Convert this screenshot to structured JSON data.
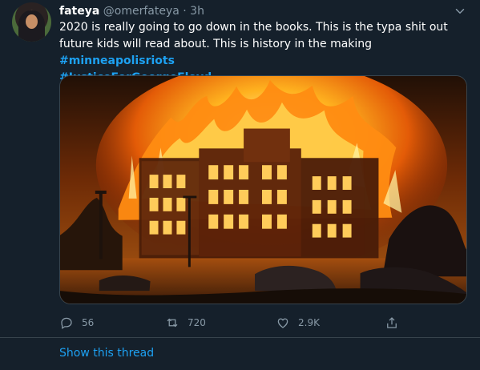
{
  "tweet": {
    "name": "fateya",
    "handle": "@omerfateya",
    "separator": "·",
    "time": "3h",
    "text_plain": "2020 is really going to go down in the books. This is the typa shit out future kids will read about. This is history in the making",
    "hashtags": [
      "#minneapolisriots",
      "#JusticeForGeorgeFloyd"
    ],
    "media_icon": "building-fire-photo"
  },
  "actions": {
    "reply_count": "56",
    "retweet_count": "720",
    "like_count": "2.9K",
    "reply_icon": "reply-icon",
    "retweet_icon": "retweet-icon",
    "like_icon": "heart-icon",
    "share_icon": "share-icon"
  },
  "thread": {
    "link_label": "Show this thread"
  },
  "colors": {
    "background": "#15202b",
    "text": "#ffffff",
    "muted": "#8899a6",
    "accent": "#1da1f2",
    "border": "#38444d"
  }
}
